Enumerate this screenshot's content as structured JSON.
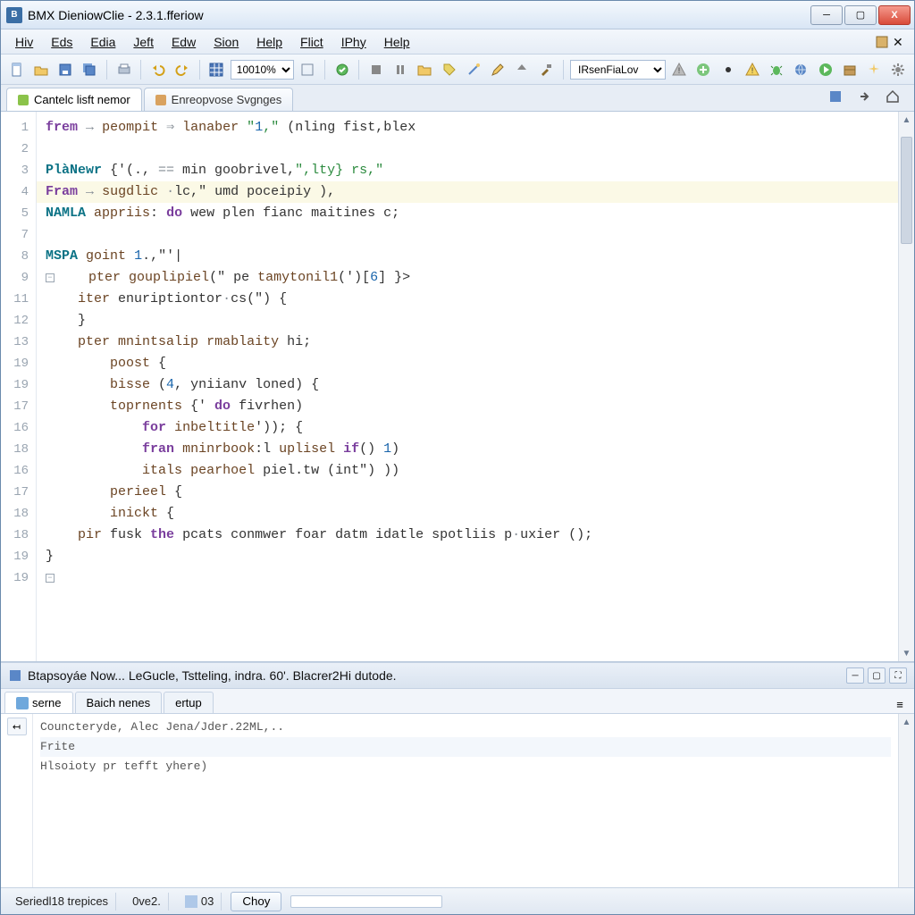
{
  "window": {
    "title": "BMX DieniowClie - 2.3.1.fferiow"
  },
  "menu": {
    "items": [
      "Hiv",
      "Eds",
      "Edia",
      "Jeft",
      "Edw",
      "Sion",
      "Help",
      "Flict",
      "IPhy",
      "Help"
    ]
  },
  "toolbar": {
    "zoom": "10010%",
    "config": "IRsenFiaLov"
  },
  "tabs": {
    "items": [
      "Cantelc lisft nemor",
      "Enreopvose Svgnges"
    ],
    "activeIndex": 0
  },
  "code": {
    "lines": [
      {
        "n": "1",
        "t": "frem",
        "rest": " → peompit ⇒ lanaber \"1,\" (nling fist,blex"
      },
      {
        "n": "2",
        "plain": ""
      },
      {
        "n": "3",
        "plain": "PlàNewr {'(., == min goobrivel,\",lty} rs,\""
      },
      {
        "n": "4",
        "plain": "Fram → sugdlic ·lc,\" umd poceipiy ),",
        "hl": true
      },
      {
        "n": "5",
        "plain": "NAMLA appriis: do wew plen fianc maitines c;"
      },
      {
        "n": "7",
        "plain": ""
      },
      {
        "n": "8",
        "plain": "MSPA goint 1.,\"'|"
      },
      {
        "n": "9",
        "plain": "    pter gouplipiel(\" pe tamytonil1(')[6] }>",
        "fold": true
      },
      {
        "n": "11",
        "plain": "    iter enuriptiontor·cs(\") {"
      },
      {
        "n": "12",
        "plain": "    }"
      },
      {
        "n": "13",
        "plain": "    pter mnintsalip rmablaity hi;"
      },
      {
        "n": "19",
        "plain": "        poost {"
      },
      {
        "n": "19",
        "plain": "        bisse (4, yniianv loned) {"
      },
      {
        "n": "17",
        "plain": "        toprnents {' do fivrhen)"
      },
      {
        "n": "16",
        "plain": "            for inbeltitle')); {"
      },
      {
        "n": "18",
        "plain": "            fran mninrbook:l uplisel if() 1)"
      },
      {
        "n": "16",
        "plain": "            itals pearhoel piel.tw (int\") ))"
      },
      {
        "n": "17",
        "plain": "        perieel {"
      },
      {
        "n": "18",
        "plain": "        inickt {"
      },
      {
        "n": "18",
        "plain": "    pir fusk the pcats conmwer foar datm idatle spotliis p·uxier ();"
      },
      {
        "n": "19",
        "plain": "}"
      },
      {
        "n": "19",
        "plain": "",
        "fold": true
      }
    ]
  },
  "bottomPanel": {
    "title": "Btapsoyáe Now... LeGucle, Tstteling, indra. 60'. Blacrer2Hi dutode.",
    "tabs": [
      "serne",
      "Baich nenes",
      "ertup"
    ],
    "activeTab": 0,
    "rows": [
      "Councteryde, Alec Jena/Jder.22ML,..",
      "Frite",
      "Hlsoioty pr tefft yhere)"
    ]
  },
  "status": {
    "left": "Seriedl18 trepices",
    "pos": "0ve2.",
    "num": "03",
    "btn": "Choy"
  }
}
